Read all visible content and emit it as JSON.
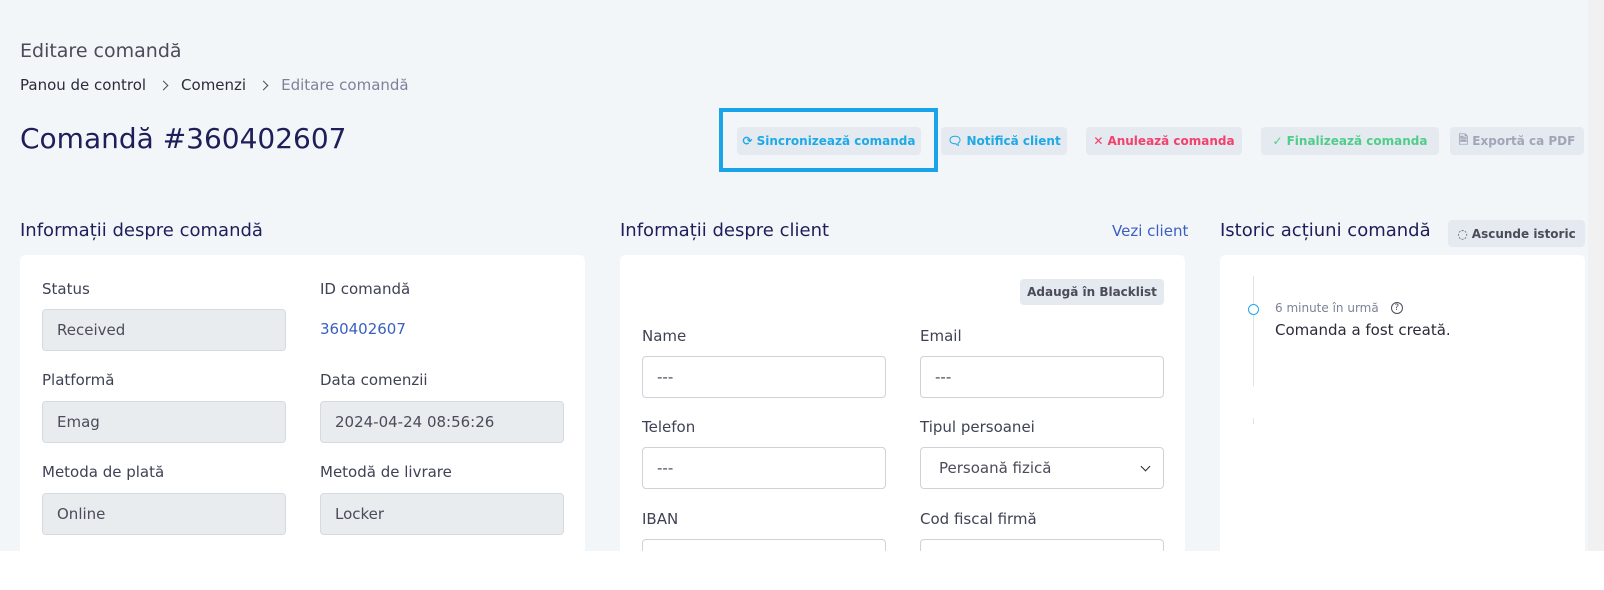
{
  "header": {
    "toolbar_title": "Editare comandă",
    "breadcrumb": [
      "Panou de control",
      "Comenzi",
      "Editare comandă"
    ],
    "order_title": "Comandă #360402607"
  },
  "actions": {
    "sync": "Sincronizează comanda",
    "notify": "Notifică client",
    "cancel": "Anulează comanda",
    "finalize": "Finalizează comanda",
    "export": "Exportă ca PDF"
  },
  "order_info": {
    "title": "Informații despre comandă",
    "status_label": "Status",
    "status_value": "Received",
    "id_label": "ID comandă",
    "id_value": "360402607",
    "platform_label": "Platformă",
    "platform_value": "Emag",
    "date_label": "Data comenzii",
    "date_value": "2024-04-24 08:56:26",
    "payment_label": "Metoda de plată",
    "payment_value": "Online",
    "delivery_label": "Metodă de livrare",
    "delivery_value": "Locker"
  },
  "client_info": {
    "title": "Informații despre client",
    "view_link": "Vezi client",
    "blacklist_button": "Adaugă în Blacklist",
    "name_label": "Name",
    "name_value": "---",
    "email_label": "Email",
    "email_value": "---",
    "phone_label": "Telefon",
    "phone_value": "---",
    "person_type_label": "Tipul persoanei",
    "person_type_value": "Persoană fizică",
    "iban_label": "IBAN",
    "fiscal_code_label": "Cod fiscal firmă"
  },
  "history": {
    "title": "Istoric acțiuni comandă",
    "hide_button": "Ascunde istoric",
    "entries": [
      {
        "time": "6 minute în urmă",
        "text": "Comanda a fost creată."
      }
    ]
  },
  "colors": {
    "accent_blue": "#1fa9e6",
    "danger": "#f1416c",
    "success": "#50cd89",
    "muted": "#a1a5b7",
    "highlight": "#1aa3e8"
  },
  "icons": {
    "sync": "sync-icon",
    "notify": "chat-icon",
    "cancel": "close-icon",
    "finalize": "check-icon",
    "export": "file-pdf-icon",
    "hide": "eye-slash-icon"
  }
}
